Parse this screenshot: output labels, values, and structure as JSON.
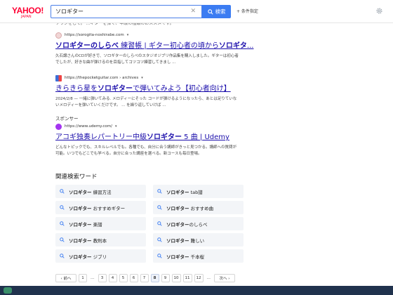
{
  "header": {
    "logo_main": "YAHOO!",
    "logo_sub": "JAPAN",
    "search_value": "ソロギター",
    "search_button": "検索",
    "conditions_link": "+ 条件指定"
  },
  "fragment_text": "ソウシをして。 ...ギターを弾く、中級の種類のおススメです。",
  "results": [
    {
      "url": "https://sorogita-noshirabe.com",
      "more": "▾",
      "title_bold": "ソロギターのしらべ",
      "title_rest": " 練習帳 | ギター初心者の頃から",
      "title_bold2": "ソロギタ",
      "title_tail": "...",
      "desc": "久石譲さんのCDが好きで、ソロギターのしらべのスタジオジブリ作品集を購入しました。ギターは初心者でしたが、好きな曲が弾けるのを目指してコツコツ練習してきまし ..."
    },
    {
      "url": "https://thepocketguitar.com › archives",
      "more": "▾",
      "title_pre": "きらきら星を",
      "title_bold": "ソロギター",
      "title_rest": "で弾いてみよう【初心者向け】",
      "desc": "2024/2/8 — 一緒に弾いてみる. メロディーにそった コードが弾けるようになったら、あとは足りていないメロディーを弾いていくだけです。 ... を繰り返していけば ..."
    }
  ],
  "sponsor_label": "スポンサー",
  "ad": {
    "url": "https://www.udemy.com/",
    "more": "▾",
    "title_pre": "アコギ独奏レパートリー中級",
    "title_bold": "ソロギター",
    "title_rest": " 5 曲 | Udemy",
    "desc": "どんなトピックでも、スキルレベルでも。各種でも、自分に合う講師がきっと見つかる。講師への質問が可能。いつでもどこでも学べる。自分に合った講座を選べる。新コースも毎日登場。"
  },
  "related": {
    "title": "関連検索ワード",
    "items": [
      {
        "bold": "ソロギター",
        "rest": " 練習方法"
      },
      {
        "bold": "ソロギター",
        "rest": " tab譜"
      },
      {
        "bold": "ソロギター",
        "rest": " おすすめギター"
      },
      {
        "bold": "ソロギター",
        "rest": " おすすめ曲"
      },
      {
        "bold": "ソロギター",
        "rest": " 楽譜"
      },
      {
        "bold": "ソロギター",
        "rest": "のしらべ"
      },
      {
        "bold": "ソロギター",
        "rest": " 教則本"
      },
      {
        "bold": "ソロギター",
        "rest": " 難しい"
      },
      {
        "bold": "ソロギター",
        "rest": " ジブリ"
      },
      {
        "bold": "ソロギター",
        "rest": " 千本桜"
      }
    ]
  },
  "pagination": {
    "prev": "‹ 前へ",
    "next": "次へ ›",
    "pages": [
      "1",
      "…",
      "3",
      "4",
      "5",
      "6",
      "7",
      "8",
      "9",
      "10",
      "11",
      "12",
      "…"
    ],
    "current": "8"
  },
  "colors": {
    "brand": "#ff0033",
    "accent": "#3b7cf2",
    "link": "#1a0dab",
    "taskbar": "#20324d"
  }
}
